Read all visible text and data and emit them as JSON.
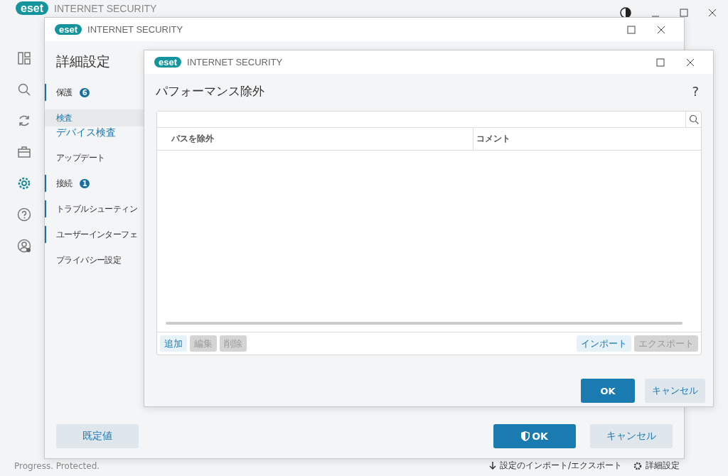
{
  "app": {
    "logo": "eset",
    "product": "INTERNET SECURITY",
    "status": "Progress. Protected.",
    "footer_links": [
      {
        "kind": "import",
        "label": "設定のインポート/エクスポート"
      },
      {
        "kind": "settings",
        "label": "詳細設定"
      }
    ]
  },
  "settings_window": {
    "logo": "eset",
    "product": "INTERNET SECURITY",
    "heading": "詳細設定",
    "nav": [
      {
        "label": "保護",
        "badge": "6",
        "marked": true,
        "selected": false
      },
      {
        "label": "検査",
        "marked": false,
        "selected": true,
        "children": [
          {
            "label": "デバイス検査"
          }
        ]
      },
      {
        "label": "アップデート",
        "marked": false,
        "selected": false
      },
      {
        "label": "接続",
        "badge": "1",
        "marked": true,
        "selected": false
      },
      {
        "label": "トラブルシューティン",
        "marked": true,
        "selected": false
      },
      {
        "label": "ユーザーインターフェ",
        "marked": true,
        "selected": false
      },
      {
        "label": "プライバシー設定",
        "marked": false,
        "selected": false
      }
    ],
    "buttons": [
      {
        "label": "既定値",
        "kind": "secondary"
      },
      {
        "label": "OK",
        "kind": "primary"
      },
      {
        "label": "キャンセル",
        "kind": "secondary"
      }
    ]
  },
  "dialog": {
    "logo": "eset",
    "product": "INTERNET SECURITY",
    "title": "パフォーマンス除外",
    "help": "?",
    "columns": [
      "パスを除外",
      "コメント"
    ],
    "left_buttons": [
      {
        "label": "追加",
        "disabled": false
      },
      {
        "label": "編集",
        "disabled": true
      },
      {
        "label": "削除",
        "disabled": true
      }
    ],
    "right_buttons": [
      {
        "label": "インポート",
        "disabled": false
      },
      {
        "label": "エクスポート",
        "disabled": true
      }
    ],
    "buttons": [
      {
        "label": "OK",
        "kind": "primary"
      },
      {
        "label": "キャンセル",
        "kind": "secondary"
      }
    ]
  }
}
